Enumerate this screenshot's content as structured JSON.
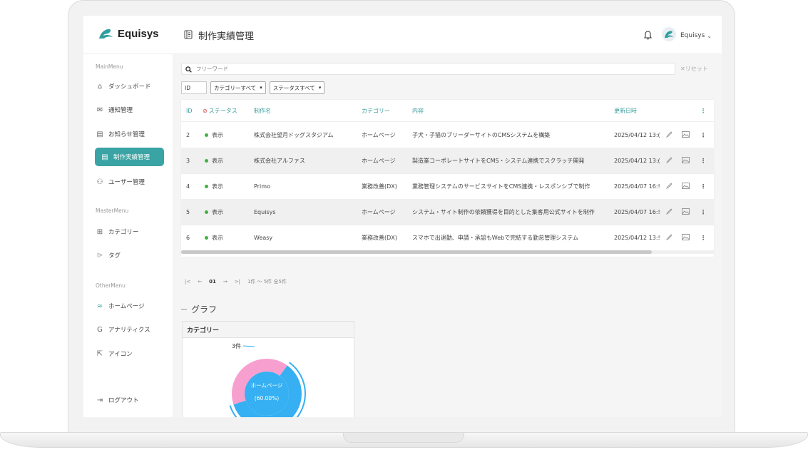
{
  "brand": {
    "name": "Equisys"
  },
  "header": {
    "title": "制作実績管理",
    "user": "Equisys"
  },
  "sidebar": {
    "main_head": "MainMenu",
    "master_head": "MasterMenu",
    "other_head": "OtherMenu",
    "items": [
      {
        "label": "ダッシュボード"
      },
      {
        "label": "通知管理"
      },
      {
        "label": "お知らせ管理"
      },
      {
        "label": "制作実績管理"
      },
      {
        "label": "ユーザー管理"
      },
      {
        "label": "カテゴリー"
      },
      {
        "label": "タグ"
      },
      {
        "label": "ホームページ"
      },
      {
        "label": "アナリティクス"
      },
      {
        "label": "アイコン"
      }
    ],
    "logout": "ログアウト"
  },
  "search": {
    "placeholder": "フリーワード",
    "reset": "リセット"
  },
  "filters": {
    "id_placeholder": "ID",
    "category": "カテゴリーすべて",
    "status": "ステータスすべて"
  },
  "table": {
    "headers": {
      "id": "ID",
      "status": "ステータス",
      "name": "制作名",
      "category": "カテゴリー",
      "content": "内容",
      "updated": "更新日時"
    },
    "rows": [
      {
        "id": "2",
        "status": "表示",
        "name": "株式会社望月ドッグスタジアム",
        "category": "ホームページ",
        "content": "子犬・子猫のブリーダーサイトのCMSシステムを構築",
        "updated": "2025/04/12 13:("
      },
      {
        "id": "3",
        "status": "表示",
        "name": "株式会社アルファス",
        "category": "ホームページ",
        "content": "製造業コーポレートサイトをCMS・システム連携でスクラッチ開発",
        "updated": "2025/04/12 13:("
      },
      {
        "id": "4",
        "status": "表示",
        "name": "Primo",
        "category": "業務改善(DX)",
        "content": "業務管理システムのサービスサイトをCMS連携・レスポンシブで制作",
        "updated": "2025/04/07 16:!"
      },
      {
        "id": "5",
        "status": "表示",
        "name": "Equisys",
        "category": "ホームページ",
        "content": "システム・サイト制作の依頼獲得を目的とした集客用公式サイトを制作",
        "updated": "2025/04/07 16:!"
      },
      {
        "id": "6",
        "status": "表示",
        "name": "Weasy",
        "category": "業務改善(DX)",
        "content": "スマホで出退勤、申請・承認もWebで完結する勤怠管理システム",
        "updated": "2025/04/12 13:!"
      }
    ]
  },
  "pager": {
    "first": "|<",
    "prev": "←",
    "current": "01",
    "next": "→",
    "last": ">|",
    "range": "1件 ～ 5件 全5件"
  },
  "graph": {
    "title": "グラフ",
    "card_title": "カテゴリー",
    "chart_data": {
      "type": "pie",
      "title": "カテゴリー",
      "slices": [
        {
          "label": "ホームページ",
          "value": 3,
          "percent": 60.0
        },
        {
          "label": "業務改善(DX)",
          "value": 2,
          "percent": 40.0
        }
      ],
      "annotation": "3件",
      "center_label": "ホームページ",
      "center_value": "(60.00%)"
    }
  },
  "colors": {
    "accent": "#3aa3a3",
    "status_ok": "#43b043",
    "slice_blue": "#36b0f2",
    "slice_pink": "#f7a0cf",
    "fab": "#ea6b8f"
  },
  "fab": {
    "label": "+"
  }
}
